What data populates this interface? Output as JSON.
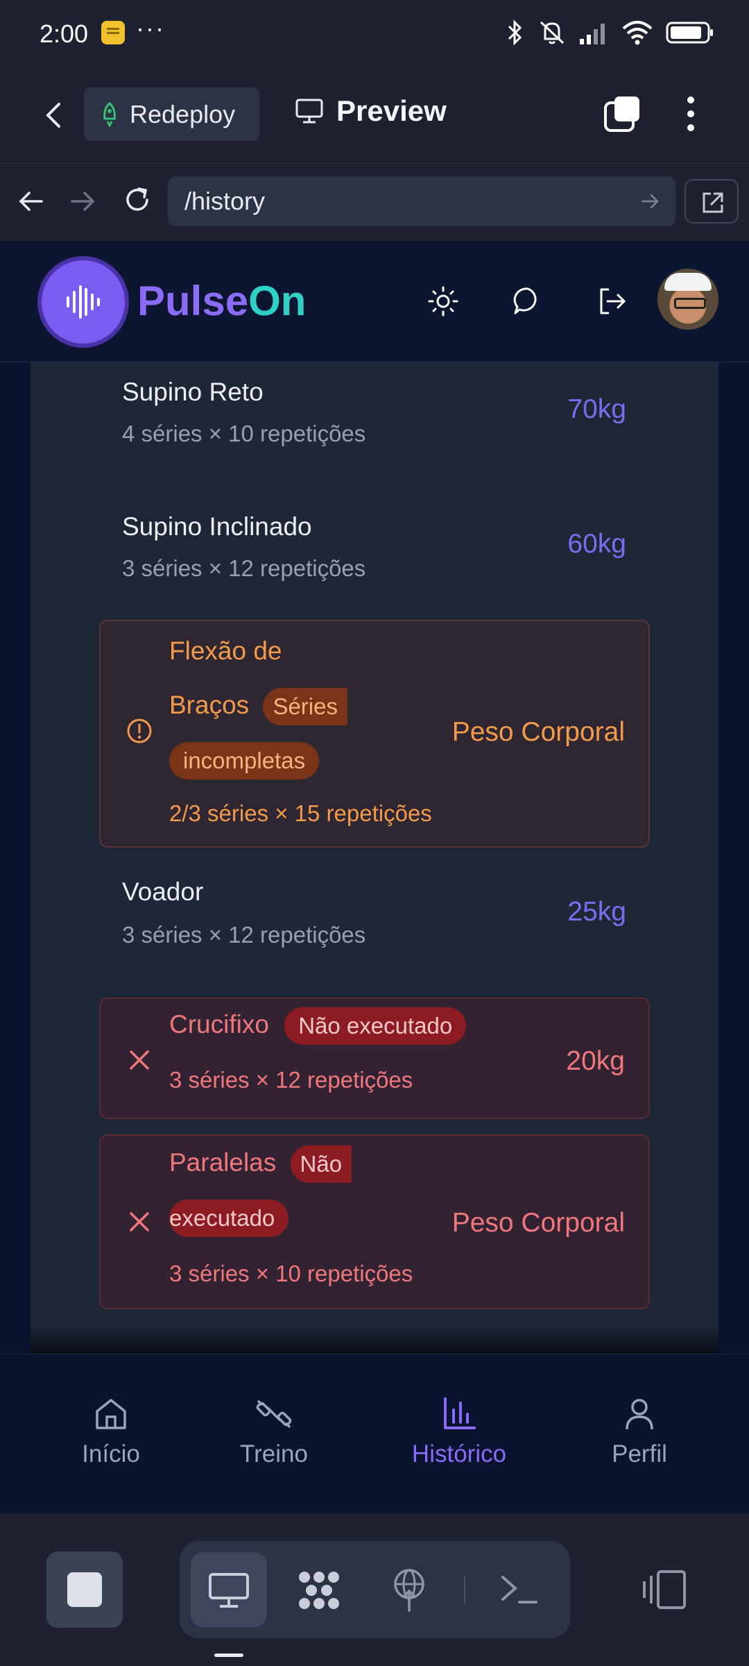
{
  "status_bar": {
    "time": "2:00",
    "overflow": "···"
  },
  "browser": {
    "redeploy_label": "Redeploy",
    "preview_label": "Preview",
    "url": "/history"
  },
  "app": {
    "brand_part1": "Pulse",
    "brand_part2": "On",
    "colors": {
      "primary": "#8b6cf6",
      "accent": "#2fd1c4",
      "warning": "#f39a4c",
      "danger": "#f0787c"
    }
  },
  "exercises": [
    {
      "name": "Supino Reto",
      "detail": "4 séries × 10 repetições",
      "weight": "70kg",
      "status": "done"
    },
    {
      "name": "Supino Inclinado",
      "detail": "3 séries × 12 repetições",
      "weight": "60kg",
      "status": "done"
    },
    {
      "name_line1": "Flexão de",
      "name_line2": "Braços",
      "badge_part1": "Séries",
      "badge_part2": "incompletas",
      "detail": "2/3 séries × 15 repetições",
      "weight": "Peso Corporal",
      "status": "incomplete"
    },
    {
      "name": "Voador",
      "detail": "3 séries × 12 repetições",
      "weight": "25kg",
      "status": "done"
    },
    {
      "name": "Crucifixo",
      "badge": "Não executado",
      "detail": "3 séries × 12 repetições",
      "weight": "20kg",
      "status": "skipped"
    },
    {
      "name": "Paralelas",
      "badge_part1": "Não",
      "badge_part2": "executado",
      "detail": "3 séries × 10 repetições",
      "weight": "Peso Corporal",
      "status": "skipped"
    }
  ],
  "bottom_nav": [
    {
      "label": "Início",
      "icon": "home-icon",
      "active": false
    },
    {
      "label": "Treino",
      "icon": "dumbbell-icon",
      "active": false
    },
    {
      "label": "Histórico",
      "icon": "bar-chart-icon",
      "active": true
    },
    {
      "label": "Perfil",
      "icon": "user-icon",
      "active": false
    }
  ]
}
